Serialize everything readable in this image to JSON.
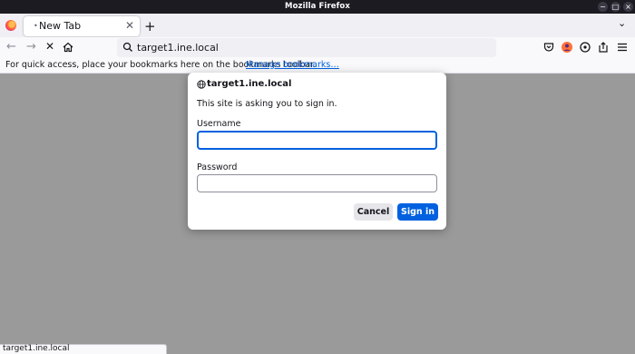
{
  "window": {
    "title": "Mozilla Firefox"
  },
  "tabs": [
    {
      "label": "New Tab"
    }
  ],
  "urlbar": {
    "value": "target1.ine.local"
  },
  "bookmarks_bar": {
    "text": "For quick access, place your bookmarks here on the bookmarks toolbar.",
    "link": "Manage bookmarks…"
  },
  "auth_dialog": {
    "host": "target1.ine.local",
    "message": "This site is asking you to sign in.",
    "username_label": "Username",
    "username_value": "",
    "password_label": "Password",
    "password_value": "",
    "cancel_label": "Cancel",
    "signin_label": "Sign in"
  },
  "status": {
    "text": "target1.ine.local"
  },
  "colors": {
    "accent": "#0061e0",
    "titlebar": "#1c1b22",
    "content_dim": "#9a9a9a"
  },
  "icons": [
    "firefox-logo-icon",
    "close-icon",
    "plus-icon",
    "chevron-down-icon",
    "back-icon",
    "forward-icon",
    "stop-icon",
    "home-icon",
    "search-icon",
    "pocket-icon",
    "account-icon",
    "extensions-icon",
    "share-icon",
    "menu-icon",
    "globe-icon"
  ]
}
